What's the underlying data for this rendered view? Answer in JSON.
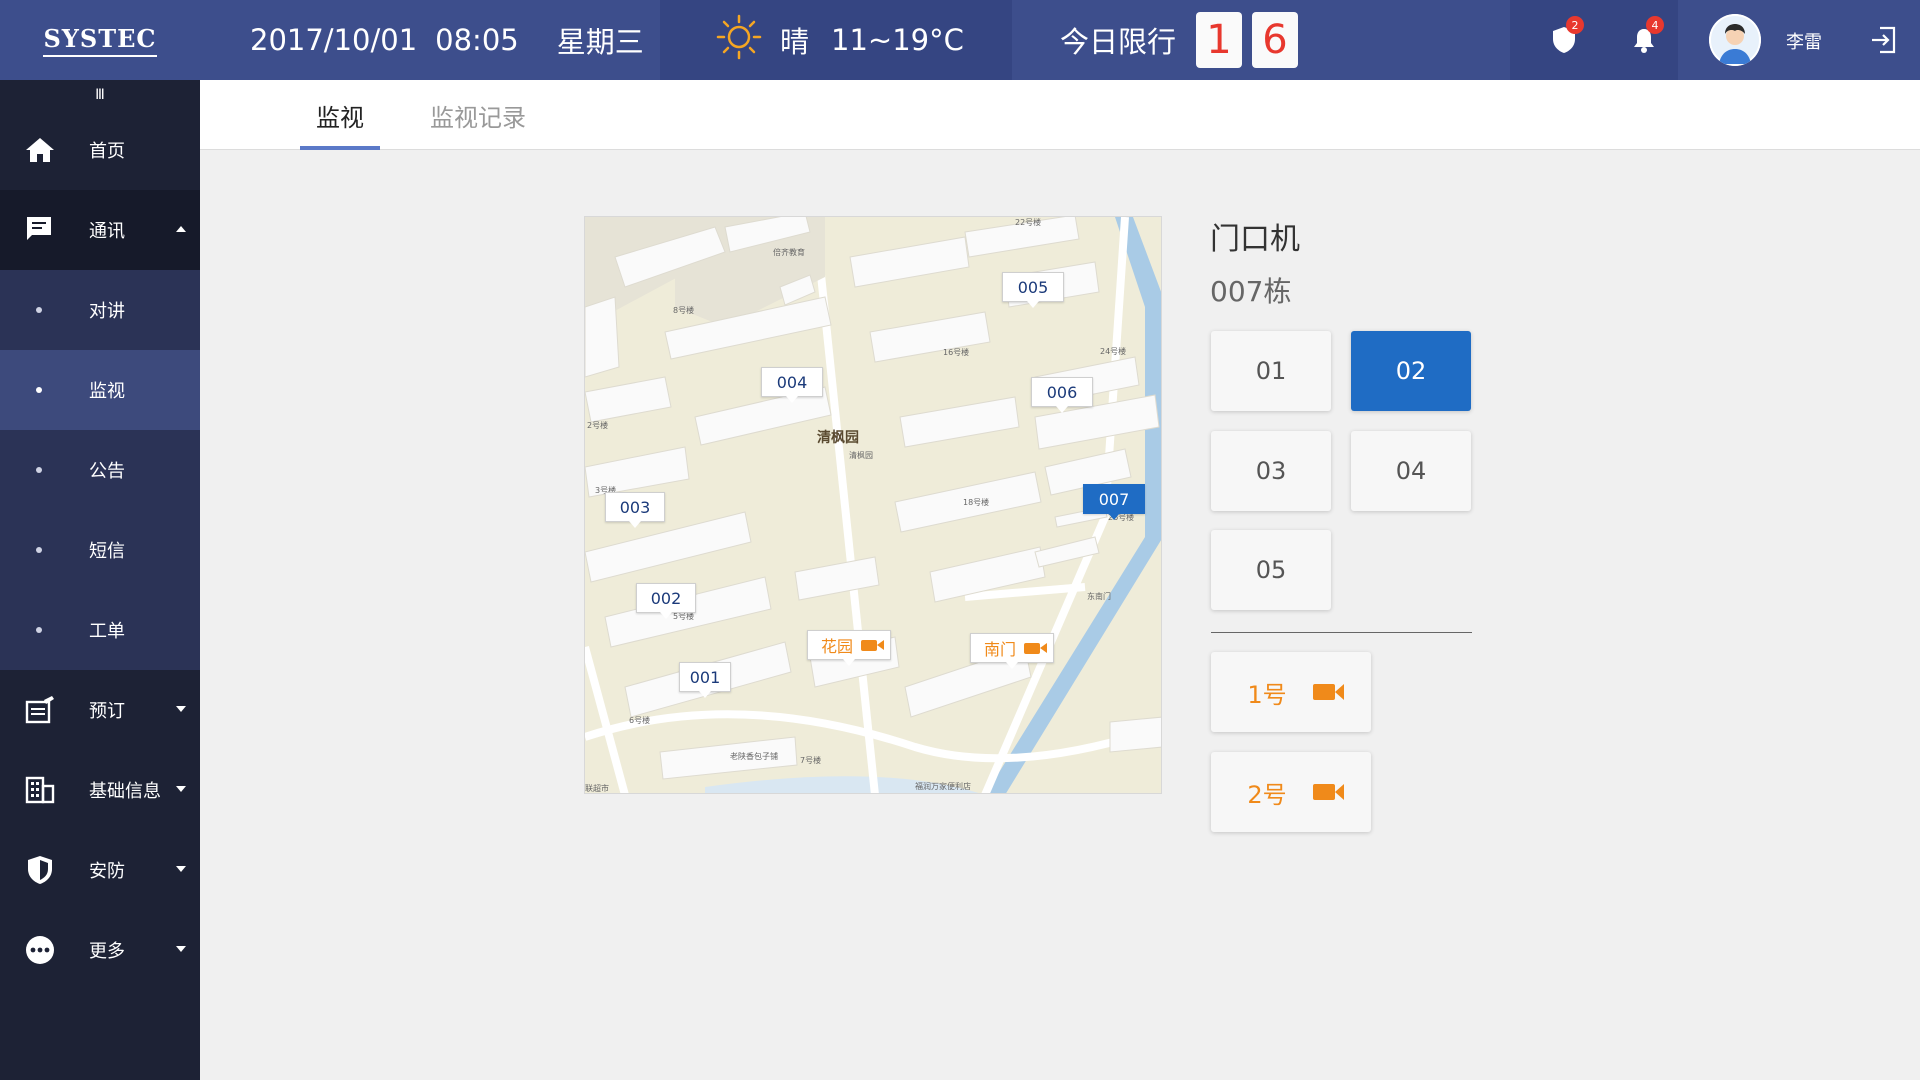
{
  "header": {
    "logo": "SYSTEC",
    "date": "2017/10/01",
    "time": "08:05",
    "weekday": "星期三",
    "weather_icon": "sun-icon",
    "weather_condition": "晴",
    "temperature": "11~19°C",
    "limit_label": "今日限行",
    "limit_digits": [
      "1",
      "6"
    ],
    "security_badge": "2",
    "notification_badge": "4",
    "username": "李雷"
  },
  "sidebar": {
    "collapse_glyph": "Ⅲ",
    "items": [
      {
        "label": "首页",
        "icon": "home-icon"
      },
      {
        "label": "通讯",
        "icon": "chat-icon",
        "expanded": true
      },
      {
        "label": "预订",
        "icon": "booking-icon"
      },
      {
        "label": "基础信息",
        "icon": "building-icon"
      },
      {
        "label": "安防",
        "icon": "shield-icon"
      },
      {
        "label": "更多",
        "icon": "more-icon"
      }
    ],
    "subitems": [
      "对讲",
      "监视",
      "公告",
      "短信",
      "工单"
    ],
    "active_subitem": "监视"
  },
  "tabs": [
    "监视",
    "监视记录"
  ],
  "map": {
    "center_label": "清枫园",
    "center_poi": "清枫园",
    "markers": [
      "001",
      "002",
      "003",
      "004",
      "005",
      "006",
      "007"
    ],
    "selected_marker": "007",
    "camera_markers": [
      "花园",
      "南门"
    ],
    "labels": [
      "倍齐教育",
      "8号楼",
      "16号楼",
      "24号楼",
      "2号楼",
      "3号楼",
      "18号楼",
      "26号楼",
      "5号楼",
      "6号楼",
      "东南门",
      "老陕香包子铺",
      "7号楼",
      "联超市",
      "福润万家便利店",
      "22号楼"
    ],
    "colors": {
      "building": "#fafafa",
      "ground": "#efecd9",
      "road": "#ffffff",
      "water": "#a9cbe6"
    }
  },
  "panel": {
    "title": "门口机",
    "building": "007栋",
    "units": [
      "01",
      "02",
      "03",
      "04",
      "05"
    ],
    "selected_unit": "02",
    "cameras": [
      "1号",
      "2号"
    ]
  },
  "colors": {
    "header": "#3d4e8c",
    "sidebar": "#1d2235",
    "accent": "#1f6cc4",
    "camera": "#f08a1a",
    "badge": "#e8382e"
  }
}
